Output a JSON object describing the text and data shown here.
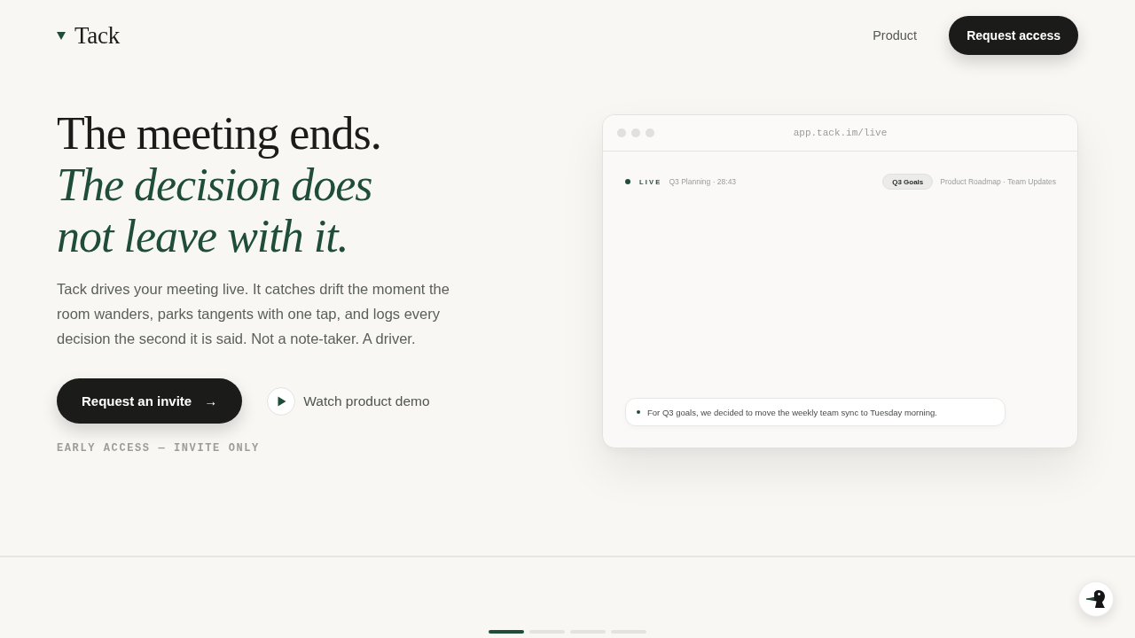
{
  "nav": {
    "logo": "Tack",
    "links": [
      "Product"
    ],
    "cta": "Request access"
  },
  "hero": {
    "headline": "The meeting ends.",
    "accent_lines": [
      "The decision does",
      "not leave with it."
    ],
    "body": "Tack drives your meeting live. It catches drift the moment the room wanders, parks tangents with one tap, and logs every decision the second it is said. Not a note-taker. A driver.",
    "primary_button": {
      "label": "Request an invite",
      "arrow": "→"
    },
    "secondary_button": "Watch product demo",
    "note": "EARLY ACCESS — INVITE ONLY"
  },
  "app_preview": {
    "url": "app.tack.im/live",
    "status": "LIVE",
    "meeting": "Q3 Planning · 28:43",
    "current_topic": "Q3 Goals",
    "upcoming_topics": "Product Roadmap · Team Updates",
    "decisions": [
      "For Q3 goals, we decided to move the weekly team sync to Tuesday morning."
    ]
  },
  "carousel": {
    "slides": [
      {
        "selected": true
      },
      {
        "selected": false
      },
      {
        "selected": false
      },
      {
        "selected": false
      }
    ]
  }
}
